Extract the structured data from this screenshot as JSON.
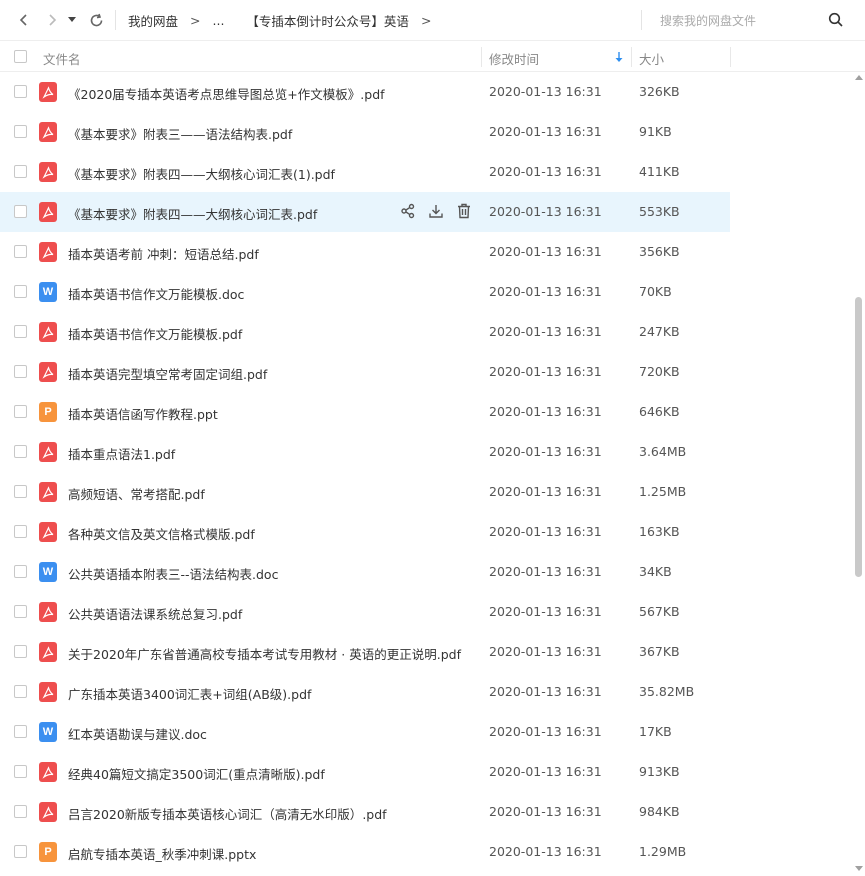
{
  "nav": {
    "crumbs": [
      "我的网盘",
      "...",
      "【专插本倒计时公众号】英语"
    ],
    "separator": ">",
    "search_placeholder": "搜索我的网盘文件"
  },
  "header": {
    "name": "文件名",
    "time": "修改时间",
    "size": "大小"
  },
  "colors": {
    "pdf": "#ee4e4e",
    "doc": "#3b8ff0",
    "ppt": "#f7943c",
    "hover_row": "#e8f5fd",
    "sort_arrow": "#2e8ff0"
  },
  "files": [
    {
      "name": "《2020届专插本英语考点思维导图总览+作文模板》.pdf",
      "type": "pdf",
      "time": "2020-01-13 16:31",
      "size": "326KB"
    },
    {
      "name": "《基本要求》附表三——语法结构表.pdf",
      "type": "pdf",
      "time": "2020-01-13 16:31",
      "size": "91KB"
    },
    {
      "name": "《基本要求》附表四——大纲核心词汇表(1).pdf",
      "type": "pdf",
      "time": "2020-01-13 16:31",
      "size": "411KB"
    },
    {
      "name": "《基本要求》附表四——大纲核心词汇表.pdf",
      "type": "pdf",
      "time": "2020-01-13 16:31",
      "size": "553KB",
      "hover": true
    },
    {
      "name": "插本英语考前 冲刺：短语总结.pdf",
      "type": "pdf",
      "time": "2020-01-13 16:31",
      "size": "356KB"
    },
    {
      "name": "插本英语书信作文万能模板.doc",
      "type": "doc",
      "time": "2020-01-13 16:31",
      "size": "70KB"
    },
    {
      "name": "插本英语书信作文万能模板.pdf",
      "type": "pdf",
      "time": "2020-01-13 16:31",
      "size": "247KB"
    },
    {
      "name": "插本英语完型填空常考固定词组.pdf",
      "type": "pdf",
      "time": "2020-01-13 16:31",
      "size": "720KB"
    },
    {
      "name": "插本英语信函写作教程.ppt",
      "type": "ppt",
      "time": "2020-01-13 16:31",
      "size": "646KB"
    },
    {
      "name": "插本重点语法1.pdf",
      "type": "pdf",
      "time": "2020-01-13 16:31",
      "size": "3.64MB"
    },
    {
      "name": "高频短语、常考搭配.pdf",
      "type": "pdf",
      "time": "2020-01-13 16:31",
      "size": "1.25MB"
    },
    {
      "name": "各种英文信及英文信格式模版.pdf",
      "type": "pdf",
      "time": "2020-01-13 16:31",
      "size": "163KB"
    },
    {
      "name": "公共英语插本附表三--语法结构表.doc",
      "type": "doc",
      "time": "2020-01-13 16:31",
      "size": "34KB"
    },
    {
      "name": "公共英语语法课系统总复习.pdf",
      "type": "pdf",
      "time": "2020-01-13 16:31",
      "size": "567KB"
    },
    {
      "name": "关于2020年广东省普通高校专插本考试专用教材 · 英语的更正说明.pdf",
      "type": "pdf",
      "time": "2020-01-13 16:31",
      "size": "367KB"
    },
    {
      "name": "广东插本英语3400词汇表+词组(AB级).pdf",
      "type": "pdf",
      "time": "2020-01-13 16:31",
      "size": "35.82MB"
    },
    {
      "name": "红本英语勘误与建议.doc",
      "type": "doc",
      "time": "2020-01-13 16:31",
      "size": "17KB"
    },
    {
      "name": "经典40篇短文搞定3500词汇(重点清晰版).pdf",
      "type": "pdf",
      "time": "2020-01-13 16:31",
      "size": "913KB"
    },
    {
      "name": "吕言2020新版专插本英语核心词汇（高清无水印版）.pdf",
      "type": "pdf",
      "time": "2020-01-13 16:31",
      "size": "984KB"
    },
    {
      "name": "启航专插本英语_秋季冲刺课.pptx",
      "type": "ppt",
      "time": "2020-01-13 16:31",
      "size": "1.29MB"
    }
  ]
}
